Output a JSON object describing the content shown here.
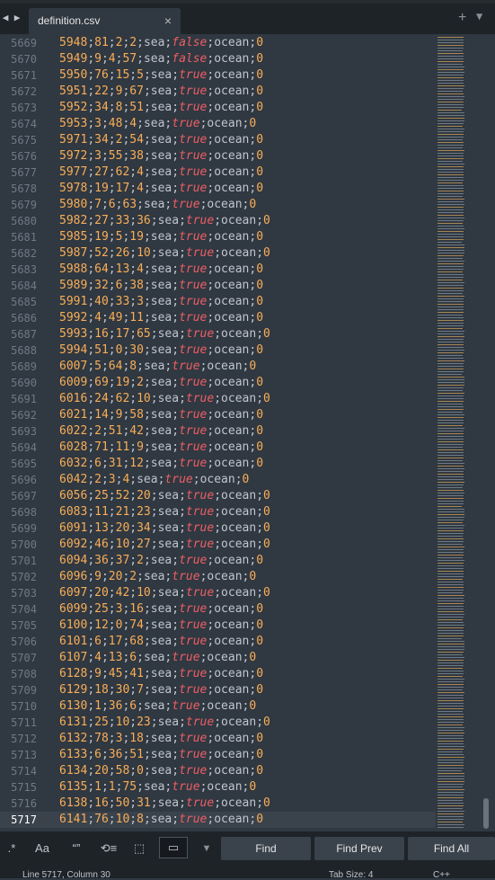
{
  "tab": {
    "title": "definition.csv",
    "close": "×"
  },
  "tabbar": {
    "nav_left": "◀",
    "nav_right": "▶",
    "new_tab": "+",
    "menu": "▼"
  },
  "editor": {
    "first_line_number": 5669,
    "current_line": 5717,
    "rows": [
      "5948;81;2;2;sea;false;ocean;0",
      "5949;9;4;57;sea;false;ocean;0",
      "5950;76;15;5;sea;true;ocean;0",
      "5951;22;9;67;sea;true;ocean;0",
      "5952;34;8;51;sea;true;ocean;0",
      "5953;3;48;4;sea;true;ocean;0",
      "5971;34;2;54;sea;true;ocean;0",
      "5972;3;55;38;sea;true;ocean;0",
      "5977;27;62;4;sea;true;ocean;0",
      "5978;19;17;4;sea;true;ocean;0",
      "5980;7;6;63;sea;true;ocean;0",
      "5982;27;33;36;sea;true;ocean;0",
      "5985;19;5;19;sea;true;ocean;0",
      "5987;52;26;10;sea;true;ocean;0",
      "5988;64;13;4;sea;true;ocean;0",
      "5989;32;6;38;sea;true;ocean;0",
      "5991;40;33;3;sea;true;ocean;0",
      "5992;4;49;11;sea;true;ocean;0",
      "5993;16;17;65;sea;true;ocean;0",
      "5994;51;0;30;sea;true;ocean;0",
      "6007;5;64;8;sea;true;ocean;0",
      "6009;69;19;2;sea;true;ocean;0",
      "6016;24;62;10;sea;true;ocean;0",
      "6021;14;9;58;sea;true;ocean;0",
      "6022;2;51;42;sea;true;ocean;0",
      "6028;71;11;9;sea;true;ocean;0",
      "6032;6;31;12;sea;true;ocean;0",
      "6042;2;3;4;sea;true;ocean;0",
      "6056;25;52;20;sea;true;ocean;0",
      "6083;11;21;23;sea;true;ocean;0",
      "6091;13;20;34;sea;true;ocean;0",
      "6092;46;10;27;sea;true;ocean;0",
      "6094;36;37;2;sea;true;ocean;0",
      "6096;9;20;2;sea;true;ocean;0",
      "6097;20;42;10;sea;true;ocean;0",
      "6099;25;3;16;sea;true;ocean;0",
      "6100;12;0;74;sea;true;ocean;0",
      "6101;6;17;68;sea;true;ocean;0",
      "6107;4;13;6;sea;true;ocean;0",
      "6128;9;45;41;sea;true;ocean;0",
      "6129;18;30;7;sea;true;ocean;0",
      "6130;1;36;6;sea;true;ocean;0",
      "6131;25;10;23;sea;true;ocean;0",
      "6132;78;3;18;sea;true;ocean;0",
      "6133;6;36;51;sea;true;ocean;0",
      "6134;20;58;0;sea;true;ocean;0",
      "6135;1;1;75;sea;true;ocean;0",
      "6138;16;50;31;sea;true;ocean;0",
      "6141;76;10;8;sea;true;ocean;0"
    ]
  },
  "find_panel": {
    "regex_label": ".*",
    "case_label": "Aa",
    "word_label": "“”",
    "wrap_label": "⟲≡",
    "selection_label": "⬚",
    "highlight_label": "▭",
    "menu_label": "▼",
    "find": "Find",
    "find_prev": "Find Prev",
    "find_all": "Find All"
  },
  "status": {
    "position": "Line 5717, Column 30",
    "tab_size": "Tab Size: 4",
    "syntax": "C++"
  },
  "colors": {
    "background": "#303841",
    "number": "#f9ae58",
    "boolean": "#ec5f66",
    "text": "#c0c5ce",
    "chrome": "#1e2328"
  }
}
